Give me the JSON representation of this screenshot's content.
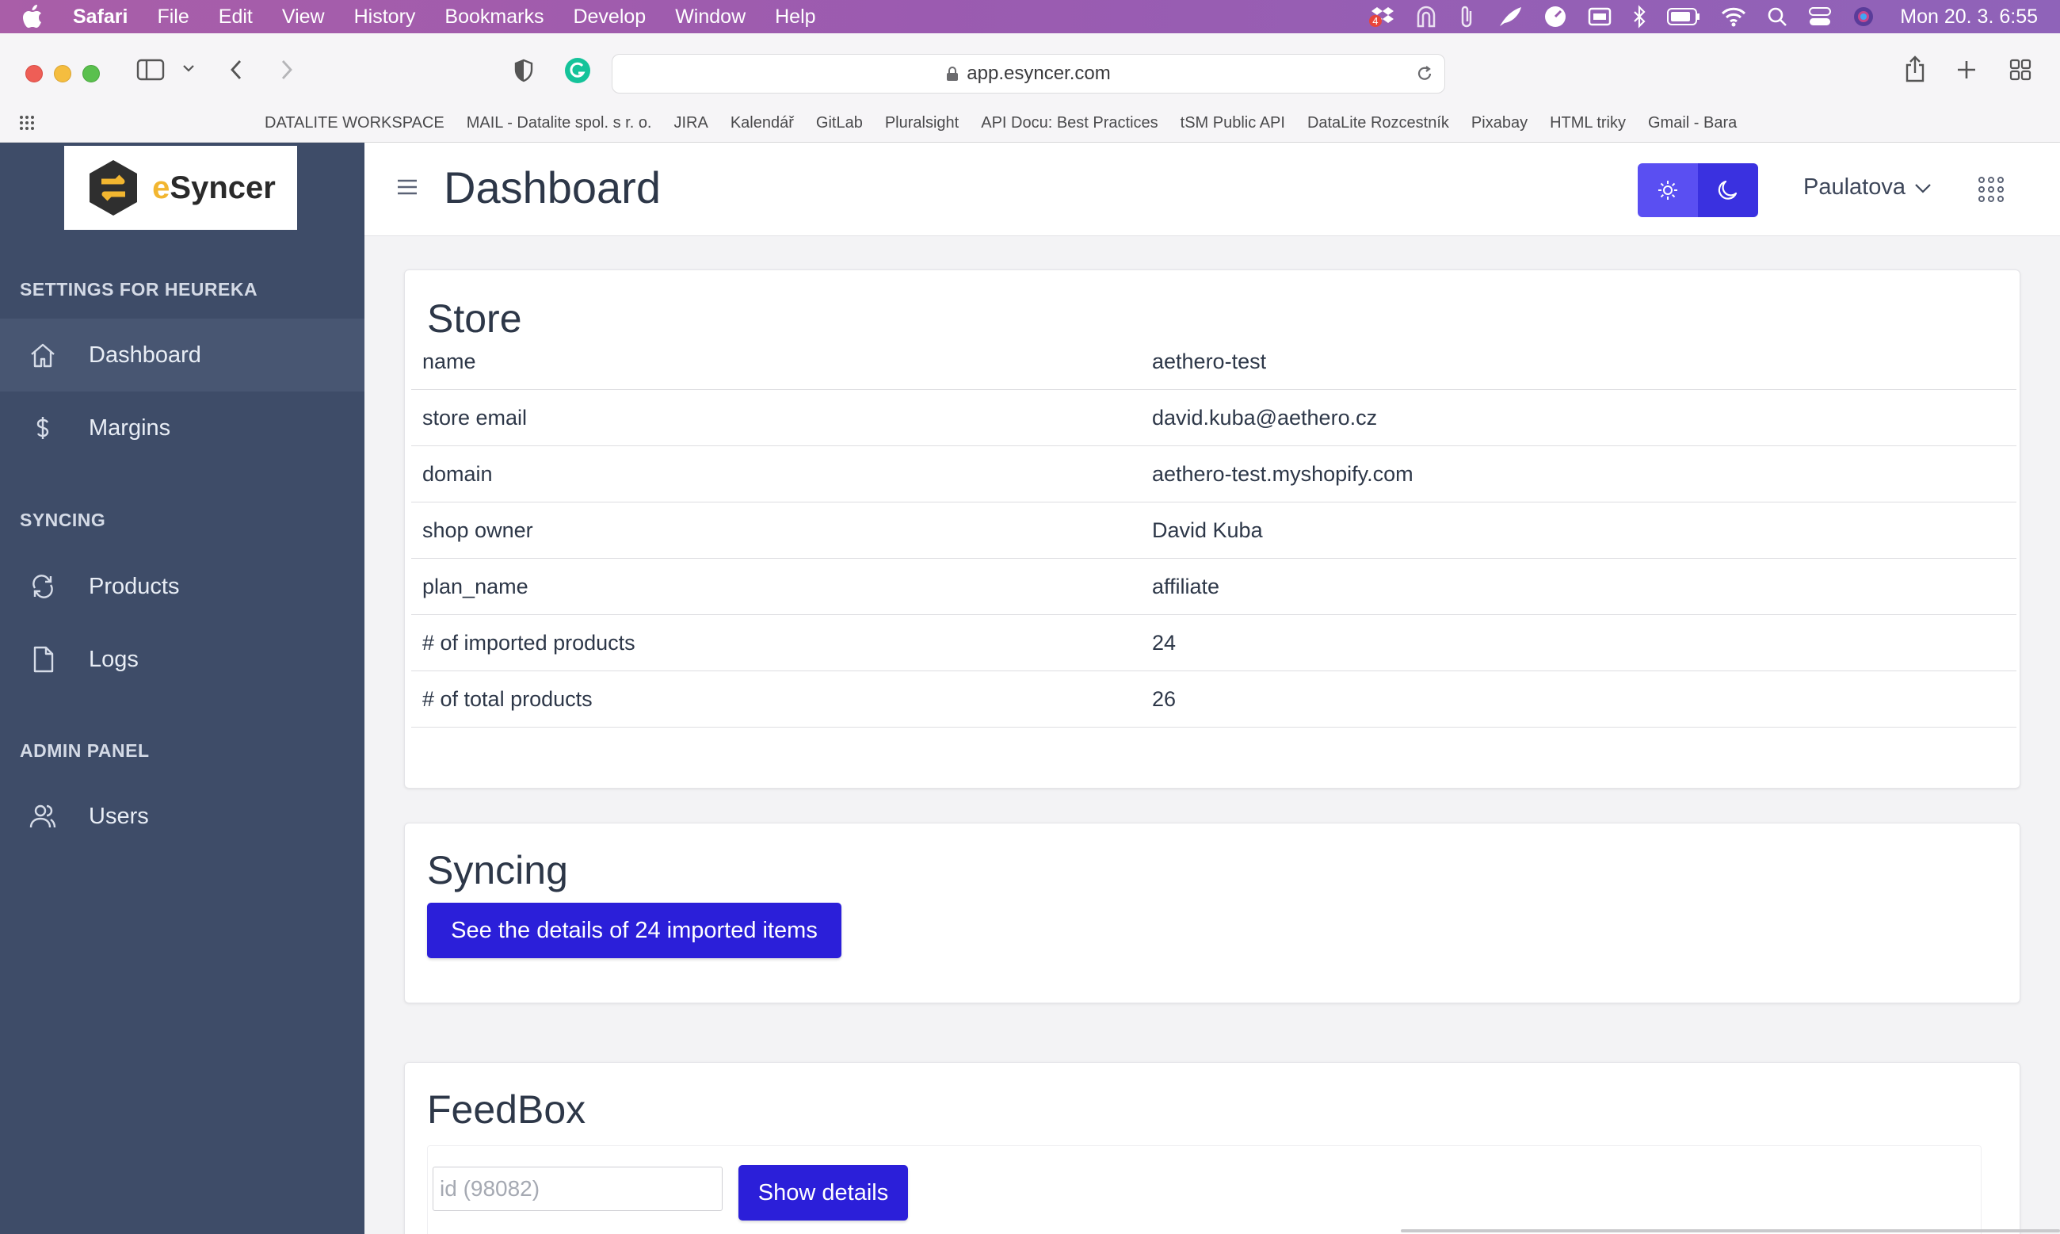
{
  "menubar": {
    "app": "Safari",
    "items": [
      "File",
      "Edit",
      "View",
      "History",
      "Bookmarks",
      "Develop",
      "Window",
      "Help"
    ],
    "clock": "Mon 20. 3.  6:55",
    "dropbox_badge": "4"
  },
  "browser": {
    "url": "app.esyncer.com",
    "favorites": [
      "DATALITE WORKSPACE",
      "MAIL - Datalite spol. s r. o.",
      "JIRA",
      "Kalendář",
      "GitLab",
      "Pluralsight",
      "API Docu: Best Practices",
      "tSM Public API",
      "DataLite Rozcestník",
      "Pixabay",
      "HTML triky",
      "Gmail - Bara"
    ]
  },
  "sidebar": {
    "brand_e": "e",
    "brand_rest": "Syncer",
    "sections": [
      {
        "header": "SETTINGS FOR HEUREKA",
        "items": [
          {
            "label": "Dashboard",
            "icon": "home-icon",
            "active": true
          },
          {
            "label": "Margins",
            "icon": "dollar-icon",
            "active": false
          }
        ]
      },
      {
        "header": "SYNCING",
        "items": [
          {
            "label": "Products",
            "icon": "sync-icon",
            "active": false
          },
          {
            "label": "Logs",
            "icon": "document-icon",
            "active": false
          }
        ]
      },
      {
        "header": "ADMIN PANEL",
        "items": [
          {
            "label": "Users",
            "icon": "users-icon",
            "active": false
          }
        ]
      }
    ]
  },
  "header": {
    "title": "Dashboard",
    "user": "Paulatova"
  },
  "store": {
    "title": "Store",
    "rows": [
      {
        "key": "name",
        "value": "aethero-test"
      },
      {
        "key": "store email",
        "value": "david.kuba@aethero.cz"
      },
      {
        "key": "domain",
        "value": "aethero-test.myshopify.com"
      },
      {
        "key": "shop owner",
        "value": "David Kuba"
      },
      {
        "key": "plan_name",
        "value": "affiliate"
      },
      {
        "key": "# of imported products",
        "value": "24"
      },
      {
        "key": "# of total products",
        "value": "26"
      }
    ]
  },
  "syncing": {
    "title": "Syncing",
    "button": "See the details of 24 imported items"
  },
  "feedbox": {
    "title": "FeedBox",
    "placeholder": "id (98082)",
    "button": "Show details"
  },
  "colors": {
    "sidebar_bg": "#3e4c68",
    "accent": "#2b1fd9",
    "menubar": "#9b5bb0"
  }
}
